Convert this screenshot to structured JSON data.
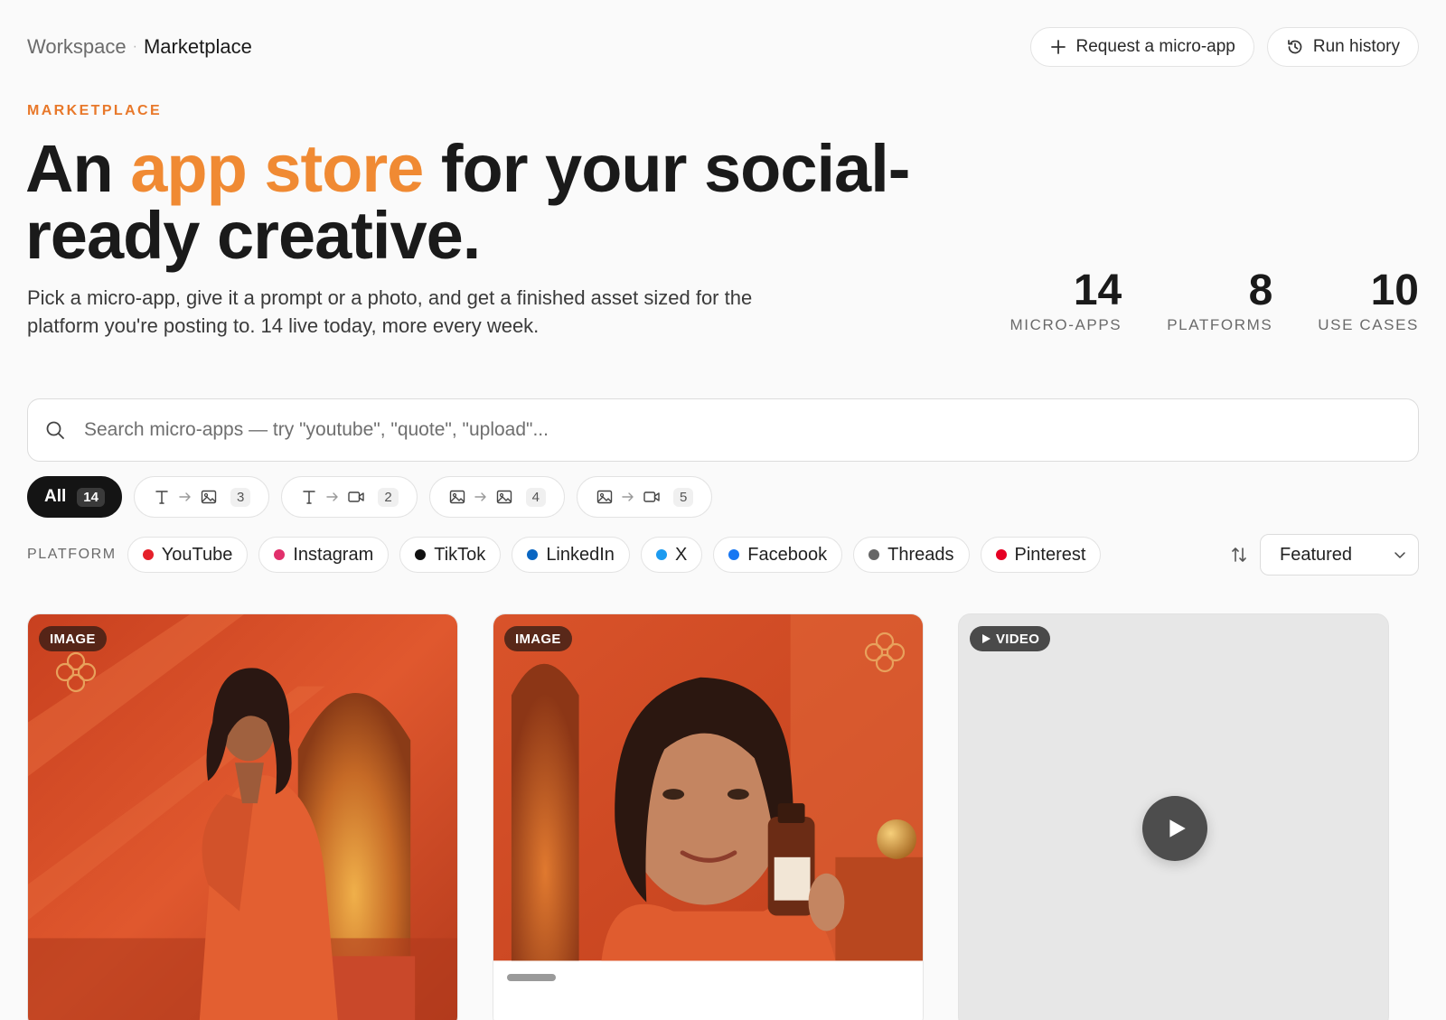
{
  "breadcrumb": {
    "root": "Workspace",
    "current": "Marketplace"
  },
  "actions": {
    "request": "Request a micro-app",
    "history": "Run history"
  },
  "hero": {
    "eyebrow": "MARKETPLACE",
    "title_part1": "An",
    "title_accent": "app store",
    "title_part2": "for your social-ready creative.",
    "subtext": "Pick a micro-app, give it a prompt or a photo, and get a finished asset sized for the platform you're posting to. 14 live today, more every week."
  },
  "stats": [
    {
      "value": "14",
      "label": "MICRO-APPS"
    },
    {
      "value": "8",
      "label": "PLATFORMS"
    },
    {
      "value": "10",
      "label": "USE CASES"
    }
  ],
  "search": {
    "placeholder": "Search micro-apps — try \"youtube\", \"quote\", \"upload\"...",
    "value": ""
  },
  "type_filters": [
    {
      "label": "All",
      "count": "14",
      "active": true
    },
    {
      "from": "text-icon",
      "to": "image-icon",
      "count": "3"
    },
    {
      "from": "text-icon",
      "to": "video-icon",
      "count": "2"
    },
    {
      "from": "image-icon",
      "to": "image-icon",
      "count": "4"
    },
    {
      "from": "image-icon",
      "to": "video-icon",
      "count": "5"
    }
  ],
  "platform_filter": {
    "label": "PLATFORM",
    "items": [
      {
        "name": "YouTube",
        "color": "#e5202a"
      },
      {
        "name": "Instagram",
        "color": "#e1306c"
      },
      {
        "name": "TikTok",
        "color": "#111111"
      },
      {
        "name": "LinkedIn",
        "color": "#0a66c2"
      },
      {
        "name": "X",
        "color": "#1d9bf0"
      },
      {
        "name": "Facebook",
        "color": "#1877f2"
      },
      {
        "name": "Threads",
        "color": "#666666"
      },
      {
        "name": "Pinterest",
        "color": "#e60023"
      }
    ]
  },
  "sort": {
    "selected": "Featured"
  },
  "cards": [
    {
      "badge": "IMAGE",
      "kind": "image"
    },
    {
      "badge": "IMAGE",
      "kind": "image"
    },
    {
      "badge": "VIDEO",
      "kind": "video"
    }
  ],
  "colors": {
    "accent": "#f08a33",
    "eyebrow": "#e8782a",
    "dark": "#141414"
  }
}
